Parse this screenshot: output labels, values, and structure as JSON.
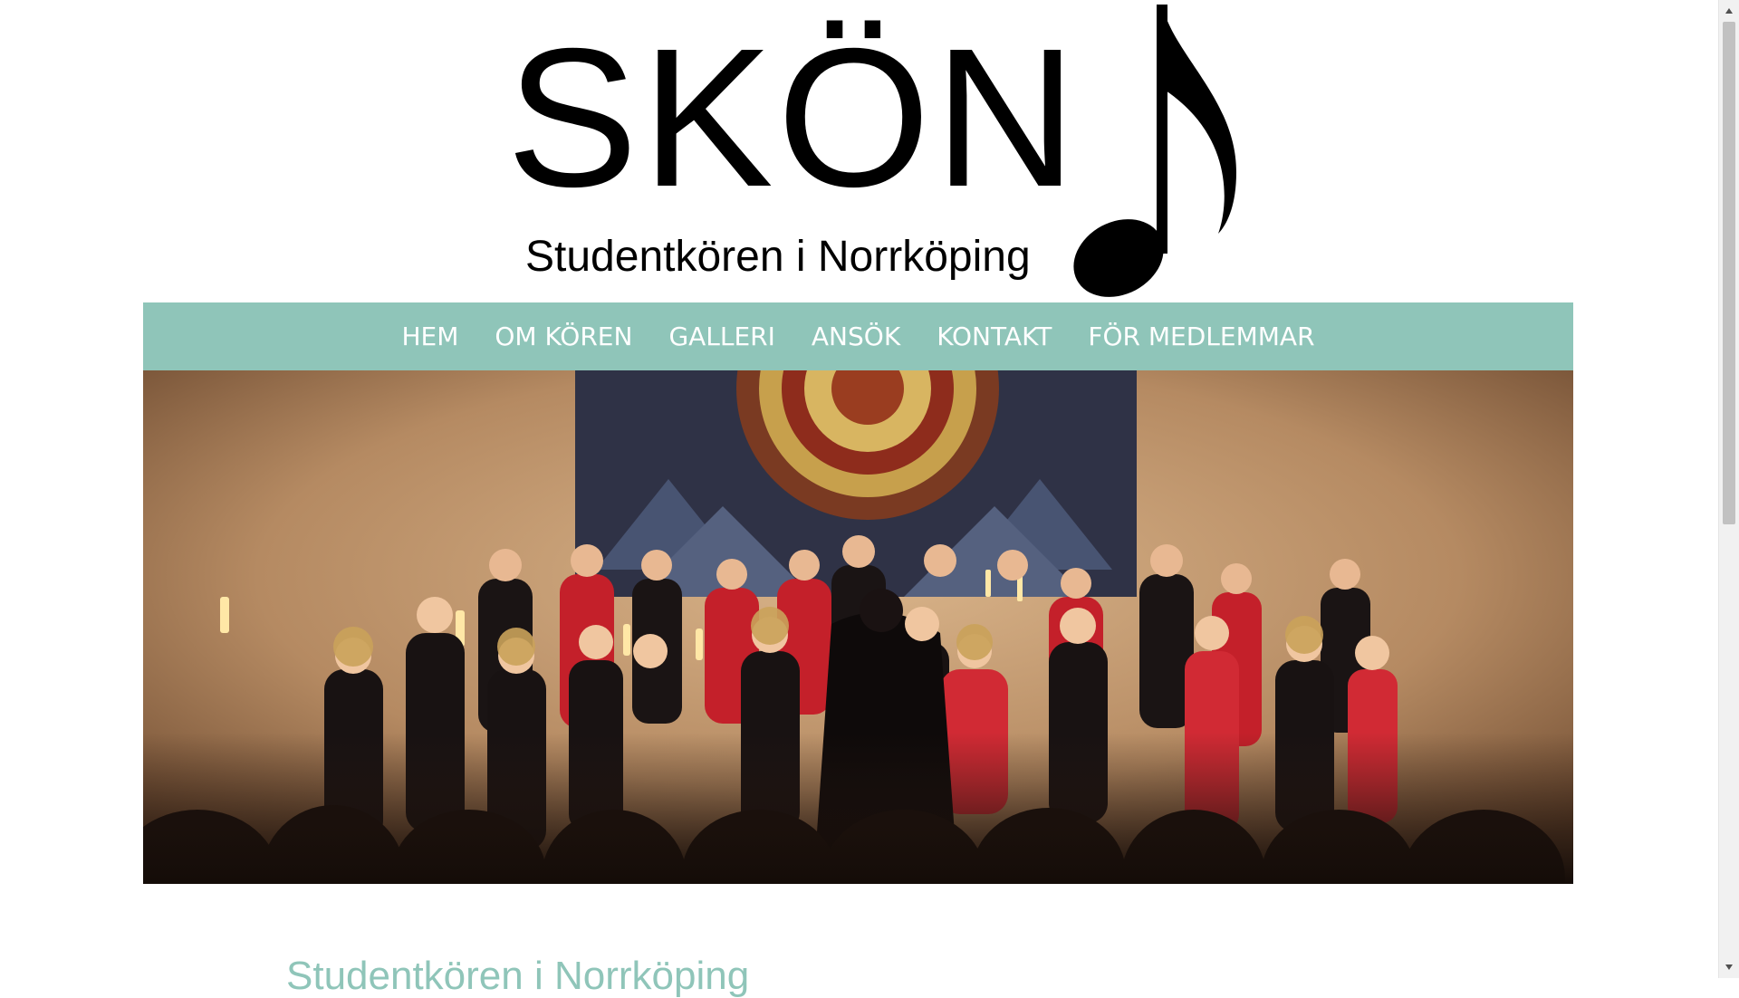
{
  "logo": {
    "title": "SKÖN",
    "subtitle": "Studentkören i Norrköping",
    "icon": "music-note-icon"
  },
  "nav": {
    "items": [
      {
        "label": "HEM"
      },
      {
        "label": "OM KÖREN"
      },
      {
        "label": "GALLERI"
      },
      {
        "label": "ANSÖK"
      },
      {
        "label": "KONTAKT"
      },
      {
        "label": "FÖR MEDLEMMAR"
      }
    ]
  },
  "hero": {
    "image": "choir-performance-photo"
  },
  "main": {
    "heading": "Studentkören i Norrköping"
  },
  "colors": {
    "accent": "#8fc5b9",
    "background": "#ffffff",
    "text_dark": "#000000"
  }
}
